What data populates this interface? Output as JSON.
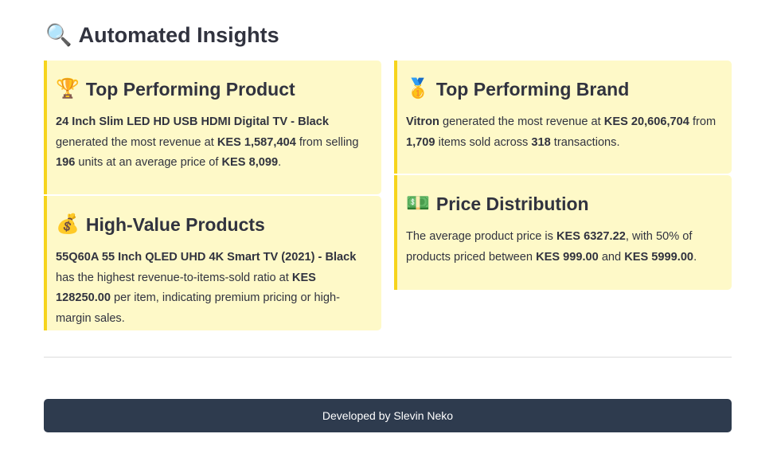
{
  "header": {
    "icon": "magnifier-icon",
    "icon_glyph": "🔍",
    "title": "Automated Insights"
  },
  "cards": {
    "top_product": {
      "icon": "trophy-icon",
      "icon_glyph": "🏆",
      "title": "Top Performing Product",
      "product_name": "24 Inch Slim LED HD USB HDMI Digital TV - Black",
      "text_1": " generated the most revenue at ",
      "revenue": "KES 1,587,404",
      "text_2": " from selling ",
      "units": "196",
      "text_3": " units at an average price of ",
      "avg_price": "KES 8,099",
      "text_4": "."
    },
    "high_value": {
      "icon": "money-bag-icon",
      "icon_glyph": "💰",
      "title": "High-Value Products",
      "product_name": "55Q60A 55 Inch QLED UHD 4K Smart TV (2021) - Black",
      "text_1": " has the highest revenue-to-items-sold ratio at ",
      "ratio": "KES 128250.00",
      "text_2": " per item, indicating premium pricing or high-margin sales."
    },
    "top_brand": {
      "icon": "medal-icon",
      "icon_glyph": "🥇",
      "title": "Top Performing Brand",
      "brand_name": "Vitron",
      "text_1": " generated the most revenue at ",
      "revenue": "KES 20,606,704",
      "text_2": " from ",
      "items": "1,709",
      "text_3": " items sold across ",
      "transactions": "318",
      "text_4": " transactions."
    },
    "price_distribution": {
      "icon": "banknote-icon",
      "icon_glyph": "💵",
      "title": "Price Distribution",
      "text_1": "The average product price is ",
      "avg_price": "KES 6327.22",
      "text_2": ", with 50% of products priced between ",
      "low": "KES 999.00",
      "text_3": " and ",
      "high": "KES 5999.00",
      "text_4": "."
    }
  },
  "footer": {
    "text": "Developed by Slevin Neko"
  },
  "colors": {
    "card_background": "#fef9c8",
    "card_border": "#f6d41c",
    "footer_background": "#2e3b4e",
    "text": "#31333f"
  }
}
